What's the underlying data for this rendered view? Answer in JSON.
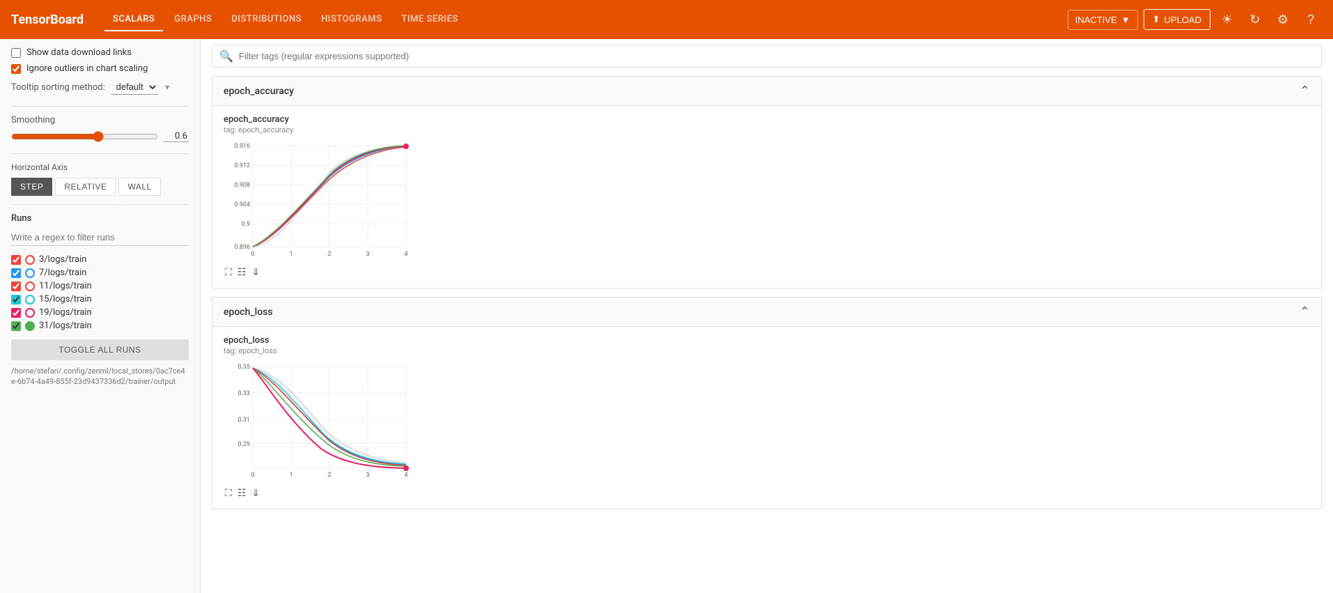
{
  "header": {
    "logo": "TensorBoard",
    "nav": [
      {
        "label": "SCALARS",
        "active": true
      },
      {
        "label": "GRAPHS",
        "active": false
      },
      {
        "label": "DISTRIBUTIONS",
        "active": false
      },
      {
        "label": "HISTOGRAMS",
        "active": false
      },
      {
        "label": "TIME SERIES",
        "active": false
      }
    ],
    "inactive_label": "INACTIVE",
    "upload_label": "UPLOAD"
  },
  "sidebar": {
    "show_data_download_links": {
      "label": "Show data download links",
      "checked": false
    },
    "ignore_outliers": {
      "label": "Ignore outliers in chart scaling",
      "checked": true
    },
    "tooltip_label": "Tooltip sorting method:",
    "tooltip_value": "default",
    "smoothing_label": "Smoothing",
    "smoothing_value": "0.6",
    "horizontal_axis_label": "Horizontal Axis",
    "axis_buttons": [
      {
        "label": "STEP",
        "active": true
      },
      {
        "label": "RELATIVE",
        "active": false
      },
      {
        "label": "WALL",
        "active": false
      }
    ],
    "runs_title": "Runs",
    "runs_filter_placeholder": "Write a regex to filter runs",
    "runs": [
      {
        "label": "3/logs/train",
        "color": "#f44336",
        "border": "#f44336",
        "checked": true,
        "filled": false
      },
      {
        "label": "7/logs/train",
        "color": "#2196f3",
        "border": "#2196f3",
        "checked": true,
        "filled": false
      },
      {
        "label": "11/logs/train",
        "color": "#f44336",
        "border": "#f44336",
        "checked": true,
        "filled": false
      },
      {
        "label": "15/logs/train",
        "color": "#26c6da",
        "border": "#26c6da",
        "checked": true,
        "filled": false
      },
      {
        "label": "19/logs/train",
        "color": "#e91e63",
        "border": "#e91e63",
        "checked": true,
        "filled": false
      },
      {
        "label": "31/logs/train",
        "color": "#4caf50",
        "border": "#4caf50",
        "checked": true,
        "filled": false
      }
    ],
    "toggle_all_label": "TOGGLE ALL RUNS",
    "run_path": "/home/stefan/.config/zenml/local_stores/0ac7ce4e-6b74-4a49-855f-23d9437336d2/trainer/output"
  },
  "main": {
    "filter_placeholder": "Filter tags (regular expressions supported)",
    "sections": [
      {
        "name": "epoch_accuracy",
        "charts": [
          {
            "title": "epoch_accuracy",
            "tag": "tag: epoch_accuracy",
            "y_values": [
              "0.916",
              "0.912",
              "0.908",
              "0.904",
              "0.9",
              "0.896"
            ],
            "x_values": [
              "0",
              "1",
              "2",
              "3",
              "4"
            ]
          }
        ]
      },
      {
        "name": "epoch_loss",
        "charts": [
          {
            "title": "epoch_loss",
            "tag": "tag: epoch_loss",
            "y_values": [
              "0.35",
              "0.33",
              "0.31",
              "0.29"
            ],
            "x_values": [
              "0",
              "1",
              "2",
              "3",
              "4"
            ]
          }
        ]
      }
    ]
  }
}
